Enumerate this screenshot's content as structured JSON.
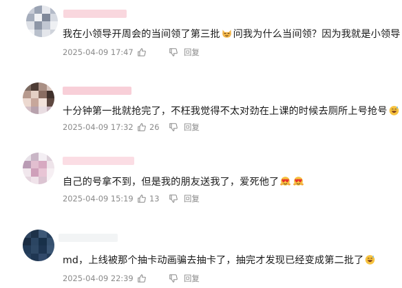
{
  "comments": [
    {
      "text_before": "我在小领导开周会的当间领了第三批",
      "text_after": "问我为什么当间领？因为我就是小领导",
      "time": "2025-04-09 17:47",
      "likes": "",
      "reply_label": "回复",
      "emoji": "cat-face-icon"
    },
    {
      "text_before": "十分钟第一批就抢完了，不枉我觉得不太对劲在上课的时候去厕所上号抢号",
      "text_after": "",
      "time": "2025-04-09 17:32",
      "likes": "26",
      "reply_label": "回复",
      "emoji": "grinning-sweat-icon"
    },
    {
      "text_before": "自己的号拿不到，但是我的朋友送我了，爱死他了",
      "text_after": "",
      "time": "2025-04-09 15:19",
      "likes": "13",
      "reply_label": "回复",
      "emoji": "heart-hands-face-icon"
    },
    {
      "text_before": "md，上线被那个抽卡动画骗去抽卡了，抽完才发现已经变成第二批了",
      "text_after": "",
      "time": "2025-04-09 22:39",
      "likes": "",
      "reply_label": "回复",
      "emoji": "grinning-sweat-icon"
    }
  ],
  "colors": {
    "nickname": "#f4b6c4",
    "meta_text": "#8a8a8a",
    "body_text": "#1a1a1a"
  }
}
